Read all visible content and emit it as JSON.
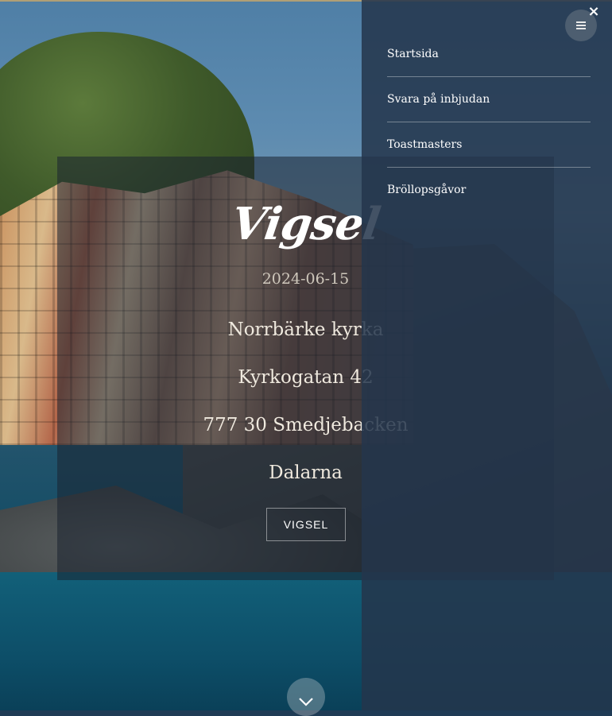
{
  "hero": {
    "title": "Vigsel",
    "date": "2024-06-15",
    "venue": "Norrbärke kyrka",
    "street": "Kyrkogatan 42",
    "postal": "777 30 Smedjebacken",
    "region": "Dalarna",
    "button_label": "VIGSEL"
  },
  "menu": {
    "items": [
      {
        "label": "Startsida"
      },
      {
        "label": "Svara på inbjudan"
      },
      {
        "label": "Toastmasters"
      },
      {
        "label": "Bröllopsgåvor"
      }
    ],
    "close_icon": "×",
    "toggle_icon": "hamburger-icon"
  },
  "scroll_icon": "chevron-down-icon"
}
